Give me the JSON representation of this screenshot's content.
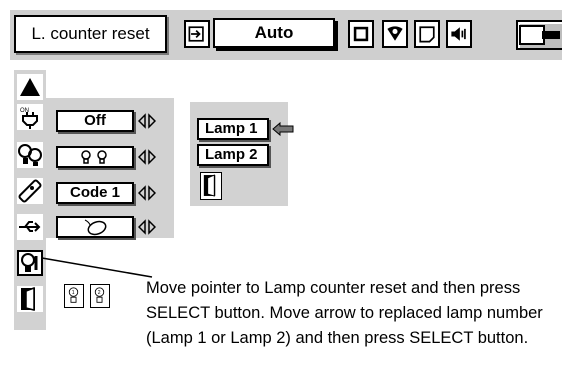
{
  "menu": {
    "title": "L. counter reset",
    "mode_value": "Auto",
    "icons": [
      "input-icon",
      "square-icon",
      "color-icon",
      "screen-icon",
      "sound-icon",
      "lamp-setting-icon"
    ]
  },
  "submenu": {
    "rows": [
      {
        "icon": "power-on-icon",
        "value": "Off"
      },
      {
        "icon": "lamp-mode-icon",
        "value": "💡💡"
      },
      {
        "icon": "remote-control-icon",
        "value": "Code 1"
      },
      {
        "icon": "usb-mouse-icon",
        "value": ""
      }
    ]
  },
  "lamp_panel": {
    "items": [
      "Lamp 1",
      "Lamp 2"
    ],
    "selected": "Lamp 1"
  },
  "instructions": "Move pointer to Lamp counter reset and then press SELECT button.  Move arrow to replaced lamp number (Lamp 1 or Lamp 2) and then press SELECT button."
}
